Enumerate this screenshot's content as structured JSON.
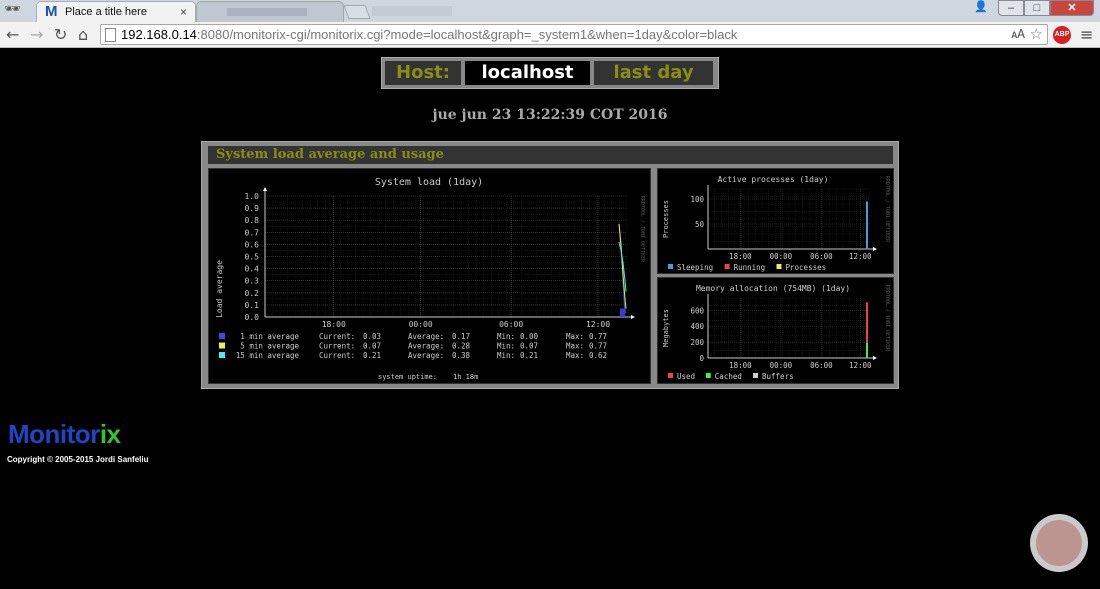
{
  "browser": {
    "tab_title": "Place a title here",
    "tab_close": "×",
    "url_host": "192.168.0.14",
    "url_rest": ":8080/monitorix-cgi/monitorix.cgi?mode=localhost&graph=_system1&when=1day&color=black",
    "abp_label": "ABP"
  },
  "header": {
    "host_label": "Host:",
    "host_value": "localhost",
    "period": "last day",
    "date": "jue jun 23 13:22:39 COT 2016"
  },
  "panel": {
    "title": "System load average and usage"
  },
  "colors": {
    "olive": "#888f12",
    "blue_1min": "#4444ee",
    "yellow_5min": "#eeee44",
    "cyan_15min": "#44eeee",
    "sleeping": "#4b9bd8",
    "running": "#ee4444",
    "used": "#ee4444",
    "cached": "#44ee44",
    "buffers": "#cccccc"
  },
  "chart_data": [
    {
      "type": "line",
      "title": "System load  (1day)",
      "ylabel": "Load average",
      "side_label": "RRDTOOL / TOBI OETIKER",
      "ylim": [
        0,
        1.0
      ],
      "yticks": [
        "1.0",
        "0.9",
        "0.8",
        "0.7",
        "0.6",
        "0.5",
        "0.4",
        "0.3",
        "0.2",
        "0.1",
        "0.0"
      ],
      "xticks": [
        "18:00",
        "00:00",
        "06:00",
        "12:00"
      ],
      "series": [
        {
          "name": "1 min average",
          "current": "0.03",
          "average": "0.17",
          "min": "0.00",
          "max": "0.77"
        },
        {
          "name": "5 min average",
          "current": "0.07",
          "average": "0.28",
          "min": "0.07",
          "max": "0.77"
        },
        {
          "name": "15 min average",
          "current": "0.21",
          "average": "0.38",
          "min": "0.21",
          "max": "0.62"
        }
      ],
      "labels": {
        "current": "Current:",
        "average": "Average:",
        "min": "Min:",
        "max": "Max:"
      },
      "uptime_label": "system uptime:",
      "uptime_value": "1h 18m"
    },
    {
      "type": "area",
      "title": "Active processes  (1day)",
      "ylabel": "Processes",
      "side_label": "RRDTOOL / TOBI OETIKER",
      "ylim": [
        0,
        120
      ],
      "yticks": [
        "100",
        "50"
      ],
      "xticks": [
        "18:00",
        "00:00",
        "06:00",
        "12:00"
      ],
      "legend": [
        "Sleeping",
        "Running",
        "Processes"
      ]
    },
    {
      "type": "area",
      "title": "Memory allocation (754MB)  (1day)",
      "ylabel": "Megabytes",
      "side_label": "RRDTOOL / TOBI OETIKER",
      "ylim": [
        0,
        754
      ],
      "yticks": [
        "600",
        "400",
        "200",
        "0"
      ],
      "xticks": [
        "18:00",
        "00:00",
        "06:00",
        "12:00"
      ],
      "legend": [
        "Used",
        "Cached",
        "Buffers"
      ]
    }
  ],
  "footer": {
    "logo_part1": "Monitor",
    "logo_part2": "ix",
    "copyright": "Copyright © 2005-2015 Jordi Sanfeliu"
  }
}
